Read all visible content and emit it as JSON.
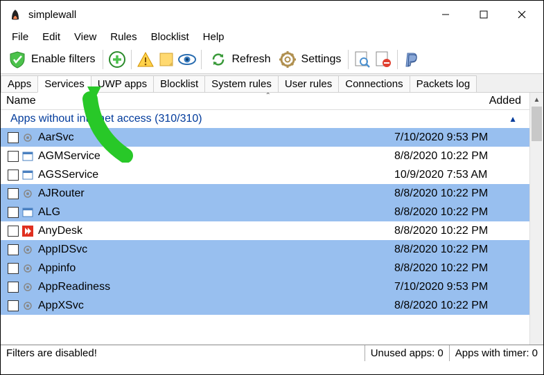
{
  "window": {
    "title": "simplewall"
  },
  "menu": {
    "file": "File",
    "edit": "Edit",
    "view": "View",
    "rules": "Rules",
    "blocklist": "Blocklist",
    "help": "Help"
  },
  "toolbar": {
    "enable_filters": "Enable filters",
    "refresh": "Refresh",
    "settings": "Settings"
  },
  "tabs": {
    "apps": "Apps",
    "services": "Services",
    "uwp": "UWP apps",
    "blocklist": "Blocklist",
    "system_rules": "System rules",
    "user_rules": "User rules",
    "connections": "Connections",
    "packets_log": "Packets log"
  },
  "columns": {
    "name": "Name",
    "added": "Added"
  },
  "group_header": "Apps without internet access (310/310)",
  "rows": [
    {
      "name": "AarSvc",
      "date": "7/10/2020 9:53 PM",
      "icon": "gear",
      "selected": true
    },
    {
      "name": "AGMService",
      "date": "8/8/2020 10:22 PM",
      "icon": "window",
      "selected": false
    },
    {
      "name": "AGSService",
      "date": "10/9/2020 7:53 AM",
      "icon": "window",
      "selected": false
    },
    {
      "name": "AJRouter",
      "date": "8/8/2020 10:22 PM",
      "icon": "gear",
      "selected": true
    },
    {
      "name": "ALG",
      "date": "8/8/2020 10:22 PM",
      "icon": "window",
      "selected": true
    },
    {
      "name": "AnyDesk",
      "date": "8/8/2020 10:22 PM",
      "icon": "anydesk",
      "selected": false
    },
    {
      "name": "AppIDSvc",
      "date": "8/8/2020 10:22 PM",
      "icon": "gear",
      "selected": true
    },
    {
      "name": "Appinfo",
      "date": "8/8/2020 10:22 PM",
      "icon": "gear",
      "selected": true
    },
    {
      "name": "AppReadiness",
      "date": "7/10/2020 9:53 PM",
      "icon": "gear",
      "selected": true
    },
    {
      "name": "AppXSvc",
      "date": "8/8/2020 10:22 PM",
      "icon": "gear",
      "selected": true
    }
  ],
  "status": {
    "main": "Filters are disabled!",
    "unused": "Unused apps: 0",
    "timer": "Apps with timer: 0"
  }
}
